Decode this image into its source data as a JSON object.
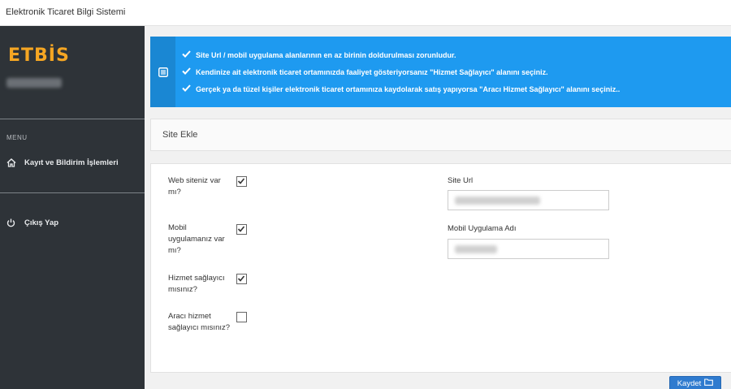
{
  "app": {
    "title": "Elektronik Ticaret Bilgi Sistemi"
  },
  "sidebar": {
    "logo": "ETBİS",
    "menu_label": "MENU",
    "items": [
      {
        "label": "Kayıt ve Bildirim İşlemleri",
        "icon": "home-icon"
      },
      {
        "label": "Çıkış Yap",
        "icon": "power-icon"
      }
    ]
  },
  "alert": {
    "icon": "list-icon",
    "lines": [
      "Site Url / mobil uygulama alanlarının en az birinin doldurulması zorunludur.",
      "Kendinize ait elektronik ticaret ortamınızda faaliyet gösteriyorsanız \"Hizmet Sağlayıcı\" alanını seçiniz.",
      "Gerçek ya da tüzel kişiler elektronik ticaret ortamınıza kaydolarak satış yapıyorsa \"Aracı Hizmet Sağlayıcı\" alanını seçiniz.."
    ]
  },
  "panel": {
    "title": "Site Ekle"
  },
  "form": {
    "questions": [
      {
        "label": "Web siteniz var mı?",
        "checked": true
      },
      {
        "label": "Mobil uygulamanız var mı?",
        "checked": true
      },
      {
        "label": "Hizmet sağlayıcı mısınız?",
        "checked": true
      },
      {
        "label": "Aracı hizmet sağlayıcı mısınız?",
        "checked": false
      }
    ],
    "site_url_label": "Site Url",
    "mobile_app_label": "Mobil Uygulama Adı"
  },
  "actions": {
    "save_label": "Kaydet"
  },
  "colors": {
    "accent": "#1e9af0",
    "sidebar": "#2e3338",
    "logo": "#f5a623",
    "button": "#2f7bcf"
  }
}
